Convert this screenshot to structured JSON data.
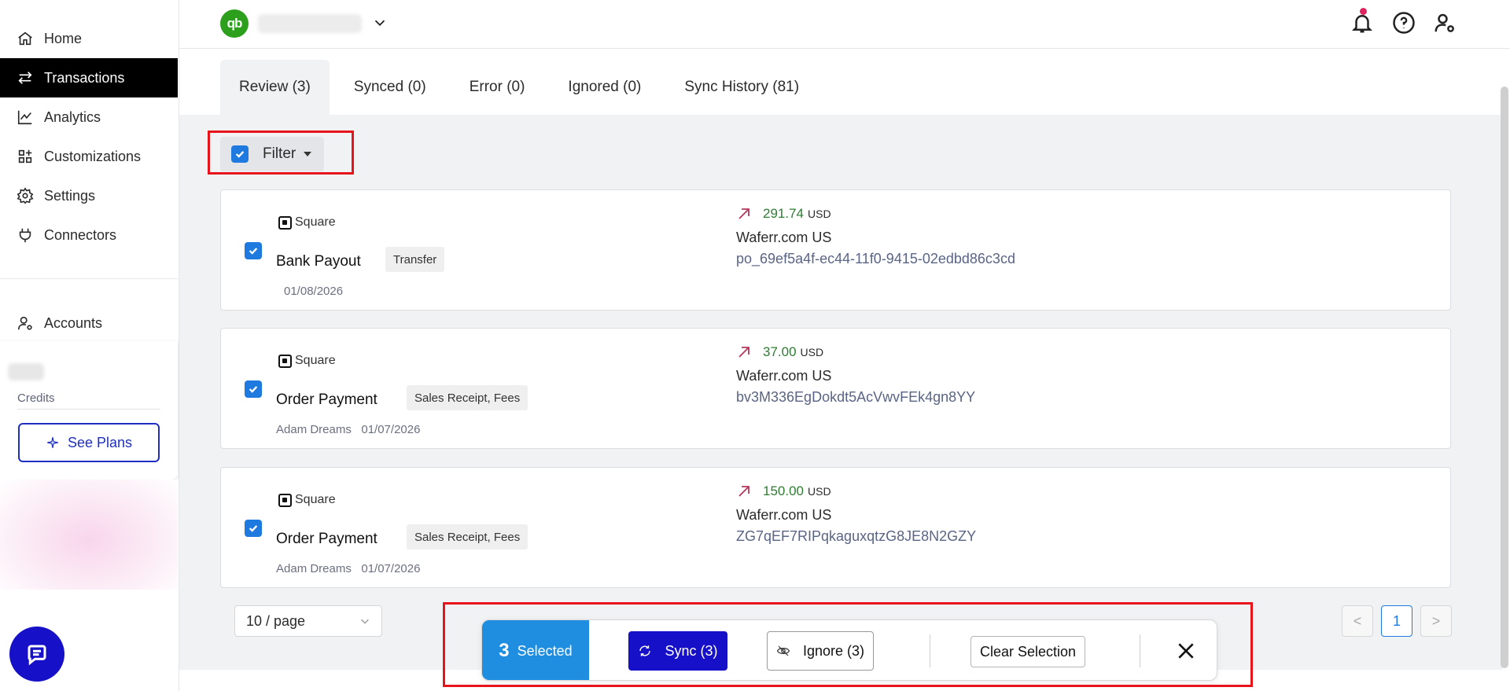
{
  "sidebar": {
    "items": [
      {
        "label": "Home",
        "icon": "home-icon"
      },
      {
        "label": "Transactions",
        "icon": "arrows-exchange-icon"
      },
      {
        "label": "Analytics",
        "icon": "line-chart-icon"
      },
      {
        "label": "Customizations",
        "icon": "grid-plus-icon"
      },
      {
        "label": "Settings",
        "icon": "gear-icon"
      },
      {
        "label": "Connectors",
        "icon": "plug-icon"
      }
    ],
    "accounts_label": "Accounts",
    "credits_label": "Credits",
    "see_plans_label": "See Plans",
    "active_item": "Transactions"
  },
  "header": {
    "logo_text": "qb",
    "icons": [
      "bell-icon",
      "help-icon",
      "user-settings-icon"
    ]
  },
  "tabs": [
    {
      "label": "Review (3)",
      "active": true
    },
    {
      "label": "Synced (0)",
      "active": false
    },
    {
      "label": "Error (0)",
      "active": false
    },
    {
      "label": "Ignored (0)",
      "active": false
    },
    {
      "label": "Sync History (81)",
      "active": false
    }
  ],
  "filter": {
    "label": "Filter",
    "checked": true
  },
  "transactions": [
    {
      "source": "Square",
      "title": "Bank Payout",
      "badge": "Transfer",
      "sub": "01/08/2026",
      "amount": "291.74",
      "currency": "USD",
      "merchant": "Waferr.com US",
      "reference": "po_69ef5a4f-ec44-11f0-9415-02edbd86c3cd",
      "checked": true
    },
    {
      "source": "Square",
      "title": "Order Payment",
      "badge": "Sales Receipt, Fees",
      "sub": "Adam Dreams   01/07/2026",
      "amount": "37.00",
      "currency": "USD",
      "merchant": "Waferr.com US",
      "reference": "bv3M336EgDokdt5AcVwvFEk4gn8YY",
      "checked": true
    },
    {
      "source": "Square",
      "title": "Order Payment",
      "badge": "Sales Receipt, Fees",
      "sub": "Adam Dreams   01/07/2026",
      "amount": "150.00",
      "currency": "USD",
      "merchant": "Waferr.com US",
      "reference": "ZG7qEF7RIPqkaguxqtzG8JE8N2GZY",
      "checked": true
    }
  ],
  "pagination": {
    "per_page": "10 / page",
    "prev": "<",
    "current": "1",
    "next": ">"
  },
  "action_bar": {
    "selected_count": "3",
    "selected_label": "Selected",
    "sync_label": "Sync (3)",
    "ignore_label": "Ignore (3)",
    "clear_label": "Clear Selection"
  },
  "colors": {
    "brand_blue": "#1710c9",
    "accent_blue": "#1f7ae0",
    "selected_blue": "#1f8de0",
    "amount_green": "#2e7d32",
    "highlight_red": "#e8141b",
    "qb_green": "#2ca01c"
  }
}
